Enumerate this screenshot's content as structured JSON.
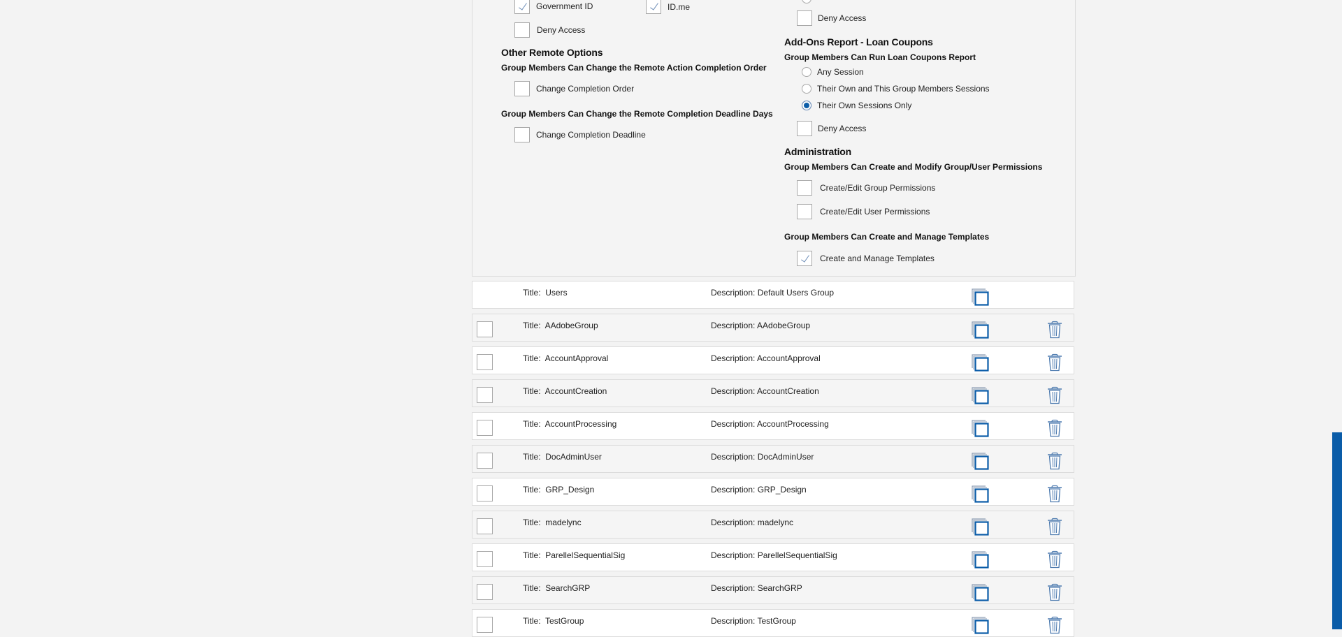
{
  "permissions": {
    "left": {
      "identity": {
        "gov_id_label": "Government ID",
        "idme_label": "ID.me",
        "deny_label": "Deny Access"
      },
      "other_remote": {
        "title": "Other Remote Options",
        "order_subtitle": "Group Members Can Change the Remote Action Completion Order",
        "order_label": "Change Completion Order",
        "deadline_subtitle": "Group Members Can Change the Remote Completion Deadline Days",
        "deadline_label": "Change Completion Deadline"
      }
    },
    "right": {
      "top_deny_label": "Deny Access",
      "loan_coupons": {
        "title": "Add-Ons Report - Loan Coupons",
        "subtitle": "Group Members Can Run Loan Coupons Report",
        "options": [
          "Any Session",
          "Their Own and This Group Members Sessions",
          "Their Own Sessions Only"
        ],
        "selected": "Their Own Sessions Only",
        "deny_label": "Deny Access"
      },
      "administration": {
        "title": "Administration",
        "perm_subtitle": "Group Members Can Create and Modify Group/User Permissions",
        "group_perm_label": "Create/Edit Group Permissions",
        "user_perm_label": "Create/Edit User Permissions",
        "templates_subtitle": "Group Members Can Create and Manage Templates",
        "templates_label": "Create and Manage Templates"
      }
    }
  },
  "groups": {
    "title_prefix": "Title:",
    "desc_prefix": "Description:",
    "rows": [
      {
        "title": "Users",
        "description": "Default Users Group"
      },
      {
        "title": "AAdobeGroup",
        "description": "AAdobeGroup"
      },
      {
        "title": "AccountApproval",
        "description": "AccountApproval"
      },
      {
        "title": "AccountCreation",
        "description": "AccountCreation"
      },
      {
        "title": "AccountProcessing",
        "description": "AccountProcessing"
      },
      {
        "title": "DocAdminUser",
        "description": "DocAdminUser"
      },
      {
        "title": "GRP_Design",
        "description": "GRP_Design"
      },
      {
        "title": "madelync",
        "description": "madelync"
      },
      {
        "title": "ParellelSequentialSig",
        "description": "ParellelSequentialSig"
      },
      {
        "title": "SearchGRP",
        "description": "SearchGRP"
      },
      {
        "title": "TestGroup",
        "description": "TestGroup"
      }
    ]
  },
  "icons": {
    "copy": "copy-icon",
    "delete": "trash-icon",
    "check": "checkmark-icon"
  },
  "colors": {
    "accent": "#0a5ca8",
    "check": "#6f8fb8",
    "scrollbar": "#0a5ca8"
  }
}
